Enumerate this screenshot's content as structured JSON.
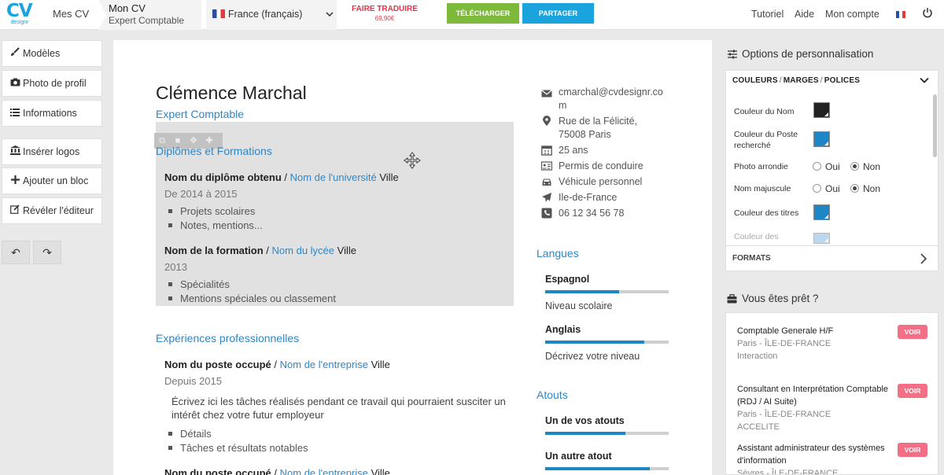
{
  "topbar": {
    "logo_text": "CV",
    "logo_sub": "designr",
    "mes_cv": "Mes CV",
    "cv_title": "Mon CV",
    "cv_subtitle": "Expert Comptable",
    "language": "France (français)",
    "translate_label": "FAIRE TRADUIRE",
    "translate_price": "69,90€",
    "download_label": "TÉLÉCHARGER",
    "share_label": "PARTAGER",
    "nav": [
      "Tutoriel",
      "Aide",
      "Mon compte"
    ]
  },
  "sidebar": {
    "items": [
      {
        "label": "Modèles",
        "icon": "brush-icon"
      },
      {
        "label": "Photo de profil",
        "icon": "camera-icon"
      },
      {
        "label": "Informations",
        "icon": "list-icon"
      },
      {
        "label": "Insérer logos",
        "icon": "bank-icon"
      },
      {
        "label": "Ajouter un bloc",
        "icon": "plus-icon"
      },
      {
        "label": "Révéler l'éditeur",
        "icon": "edit-icon"
      }
    ],
    "undo": "↶",
    "redo": "↷"
  },
  "cv": {
    "name": "Clémence Marchal",
    "position": "Expert Comptable",
    "education": {
      "title": "Diplômes et Formations",
      "entries": [
        {
          "title": "Nom du diplôme obtenu",
          "sep": " / ",
          "org": "Nom de l'université",
          "city": " Ville",
          "date": "De 2014 à 2015",
          "bullets": [
            "Projets scolaires",
            "Notes, mentions..."
          ]
        },
        {
          "title": "Nom de la formation",
          "sep": " / ",
          "org": "Nom du lycée",
          "city": " Ville",
          "date": "2013",
          "bullets": [
            "Spécialités",
            "Mentions spéciales ou classement"
          ]
        }
      ]
    },
    "experience": {
      "title": "Expériences professionnelles",
      "entries": [
        {
          "title": "Nom du poste occupé",
          "sep": " / ",
          "org": "Nom de l'entreprise",
          "city": " Ville",
          "date": "Depuis 2015",
          "text": "Écrivez ici les tâches réalisés pendant ce travail qui pourraient susciter un intérêt chez votre futur employeur",
          "bullets": [
            "Détails",
            "Tâches et résultats notables"
          ]
        },
        {
          "title": "Nom du poste occupé",
          "sep": " / ",
          "org": "Nom de l'entreprise",
          "city": " Ville"
        }
      ]
    },
    "contact": [
      {
        "icon": "mail-icon",
        "text": "cmarchal@cvdesignr.co\nm"
      },
      {
        "icon": "location-icon",
        "text": "Rue de la Félicité,\n75008 Paris"
      },
      {
        "icon": "calendar-icon",
        "text": "25 ans"
      },
      {
        "icon": "id-card-icon",
        "text": "Permis de conduire"
      },
      {
        "icon": "car-icon",
        "text": "Véhicule personnel"
      },
      {
        "icon": "plane-icon",
        "text": "Ile-de-France"
      },
      {
        "icon": "phone-icon",
        "text": "06 12 34 56 78"
      }
    ],
    "languages": {
      "title": "Langues",
      "items": [
        {
          "name": "Espagnol",
          "level_text": "Niveau scolaire",
          "level": 0.6
        },
        {
          "name": "Anglais",
          "level_text": "Décrivez votre niveau",
          "level": 0.8
        }
      ]
    },
    "assets": {
      "title": "Atouts",
      "items": [
        {
          "name": "Un de vos atouts",
          "level": 0.65
        },
        {
          "name": "Un autre atout",
          "level": 0.85
        }
      ]
    }
  },
  "options": {
    "title": "Options de personnalisation",
    "tabs": [
      "COULEURS",
      "MARGES",
      "POLICES"
    ],
    "rows": {
      "name_color": {
        "label": "Couleur du Nom",
        "color": "#222222"
      },
      "position_color": {
        "label": "Couleur du Poste recherché",
        "color": "#1f86c6"
      },
      "round_photo": {
        "label": "Photo arrondie",
        "yes": "Oui",
        "no": "Non",
        "selected": "Non"
      },
      "uppercase_name": {
        "label": "Nom majuscule",
        "yes": "Oui",
        "no": "Non",
        "selected": "Non"
      },
      "title_color": {
        "label": "Couleur des titres",
        "color": "#1f86c6"
      },
      "more": {
        "label": "Couleur des",
        "color": "#bcd8ee"
      }
    },
    "formats": "FORMATS"
  },
  "ready": {
    "title": "Vous êtes prêt ?",
    "button": "VOIR",
    "jobs": [
      {
        "title": "Comptable Generale H/F",
        "location": "Paris - ÎLE-DE-FRANCE",
        "company": "Interaction"
      },
      {
        "title": "Consultant en Interprétation Comptable (RDJ / AI Suite)",
        "location": "Paris - ÎLE-DE-FRANCE",
        "company": "ACCELITE"
      },
      {
        "title": "Assistant administrateur des systèmes d'information",
        "location": "Sèvres - ÎLE-DE-FRANCE",
        "company": ""
      }
    ]
  }
}
